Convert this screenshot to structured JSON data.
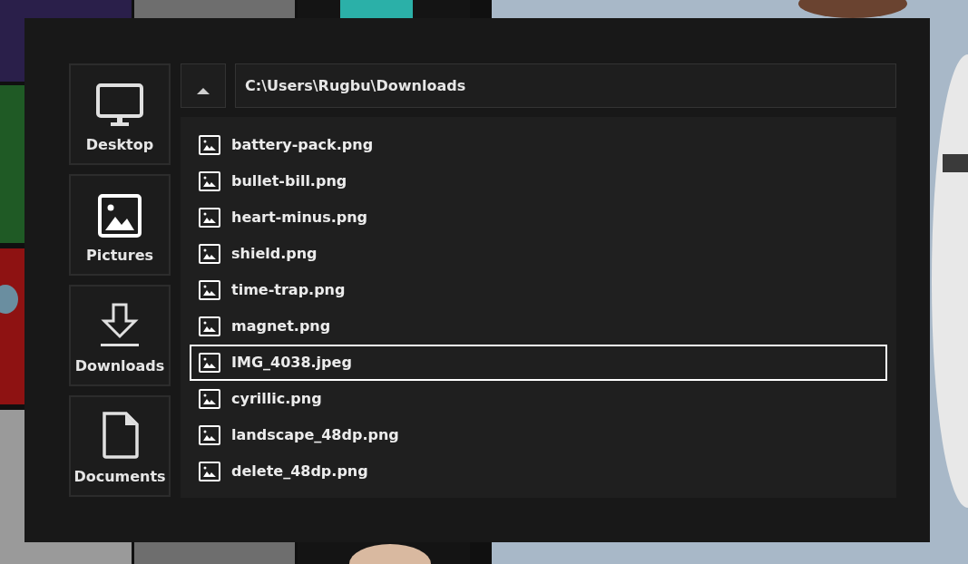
{
  "places": [
    {
      "kind": "desktop",
      "label": "Desktop"
    },
    {
      "kind": "pictures",
      "label": "Pictures"
    },
    {
      "kind": "downloads",
      "label": "Downloads"
    },
    {
      "kind": "documents",
      "label": "Documents"
    }
  ],
  "path_field": {
    "value": "C:\\Users\\Rugbu\\Downloads"
  },
  "files": [
    {
      "name": "battery-pack.png",
      "selected": false
    },
    {
      "name": "bullet-bill.png",
      "selected": false
    },
    {
      "name": "heart-minus.png",
      "selected": false
    },
    {
      "name": "shield.png",
      "selected": false
    },
    {
      "name": "time-trap.png",
      "selected": false
    },
    {
      "name": "magnet.png",
      "selected": false
    },
    {
      "name": "IMG_4038.jpeg",
      "selected": true
    },
    {
      "name": "cyrillic.png",
      "selected": false
    },
    {
      "name": "landscape_48dp.png",
      "selected": false
    },
    {
      "name": "delete_48dp.png",
      "selected": false
    }
  ]
}
